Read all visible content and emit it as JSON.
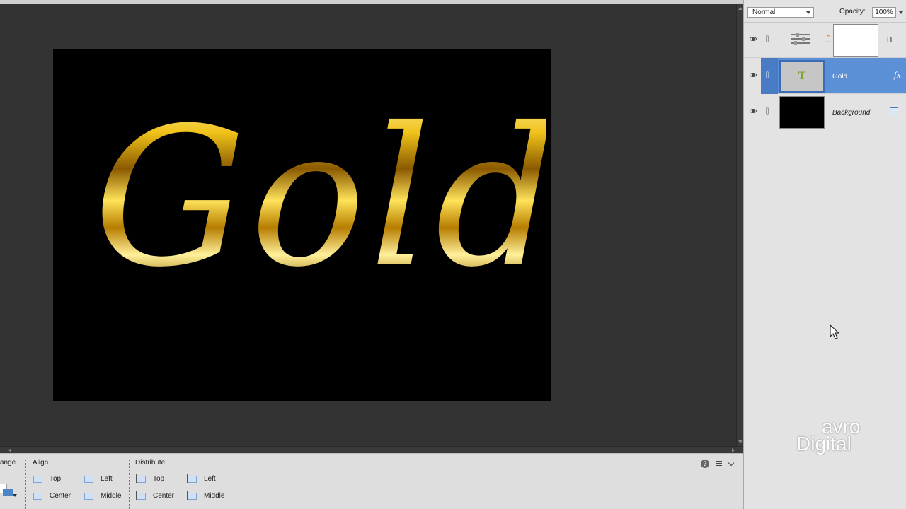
{
  "canvas": {
    "text": "Gold"
  },
  "tool_options": {
    "arrange_label": "ange",
    "align": {
      "title": "Align",
      "items": [
        "Top",
        "Center",
        "Left",
        "Middle"
      ]
    },
    "distribute": {
      "title": "Distribute",
      "items": [
        "Top",
        "Center",
        "Left",
        "Middle"
      ]
    },
    "help_icon": "question-icon",
    "menu_icon": "panel-menu-icon",
    "collapse_icon": "chevron-down-icon"
  },
  "layers_panel": {
    "blend_mode": "Normal",
    "opacity_label": "Opacity:",
    "opacity_value": "100%",
    "layers": [
      {
        "name": "H...",
        "type": "adjustment"
      },
      {
        "name": "Gold",
        "type": "text",
        "selected": true,
        "badge": "fx"
      },
      {
        "name": "Background",
        "type": "background"
      }
    ]
  },
  "watermark": {
    "line1": "avro",
    "line2": "Digital"
  },
  "colors": {
    "selection": "#5b8fd6",
    "work_area": "#333333",
    "panel": "#e3e3e3",
    "gold": "#e8b81a"
  }
}
